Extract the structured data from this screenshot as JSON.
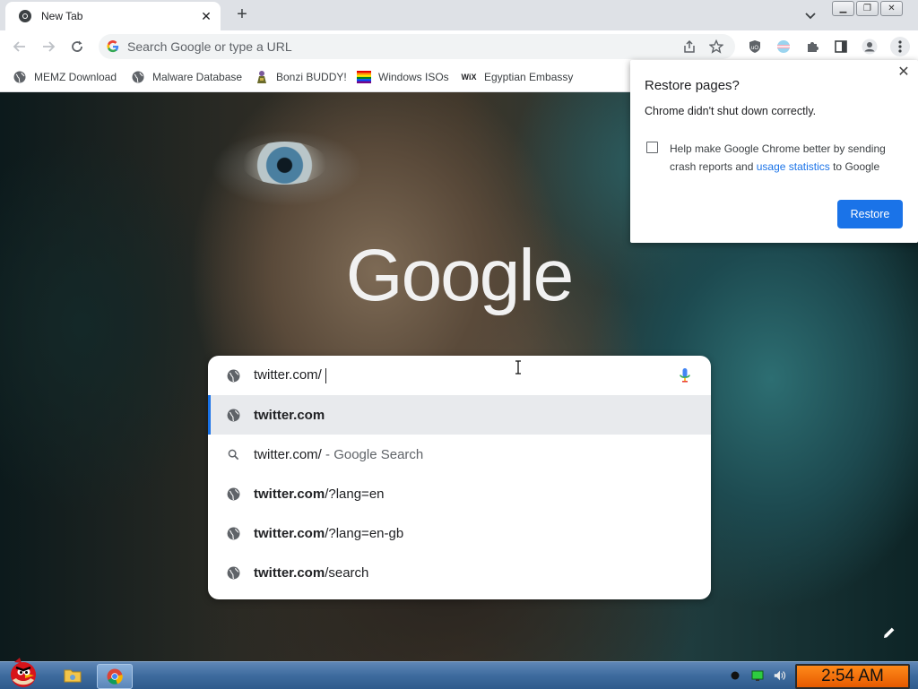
{
  "browser": {
    "tab": {
      "title": "New Tab"
    },
    "omnibox": {
      "placeholder": "Search Google or type a URL"
    },
    "bookmarks": [
      {
        "label": "MEMZ Download",
        "icon": "globe-icon"
      },
      {
        "label": "Malware Database",
        "icon": "globe-icon"
      },
      {
        "label": "Bonzi BUDDY!",
        "icon": "bonzi-icon"
      },
      {
        "label": "Windows ISOs",
        "icon": "rainbow-flag-icon"
      },
      {
        "label": "Egyptian Embassy",
        "icon": "wix-icon"
      }
    ]
  },
  "page": {
    "logo_text": "Google",
    "search_input": {
      "value": "twitter.com/"
    },
    "suggestions": [
      {
        "icon": "globe-icon",
        "bold": "twitter.com",
        "rest": "",
        "selected": true
      },
      {
        "icon": "search-icon",
        "bold": "twitter.com/",
        "rest": " - Google Search",
        "selected": false
      },
      {
        "icon": "globe-icon",
        "bold": "twitter.com",
        "rest": "/?lang=en",
        "selected": false
      },
      {
        "icon": "globe-icon",
        "bold": "twitter.com",
        "rest": "/?lang=en-gb",
        "selected": false
      },
      {
        "icon": "globe-icon",
        "bold": "twitter.com",
        "rest": "/search",
        "selected": false
      }
    ]
  },
  "restore_popup": {
    "title": "Restore pages?",
    "subtitle": "Chrome didn't shut down correctly.",
    "checkbox_text_1": "Help make Google Chrome better by sending crash reports and ",
    "checkbox_link": "usage statistics",
    "checkbox_text_2": " to Google",
    "checkbox_checked": false,
    "button": "Restore"
  },
  "taskbar": {
    "clock": "2:54 AM"
  },
  "colors": {
    "accent": "#1a73e8",
    "link": "#1a56b8",
    "clock_bg": "#ff8a1a"
  }
}
